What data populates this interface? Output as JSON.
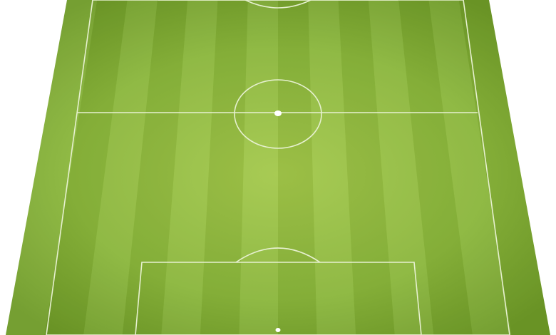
{
  "pitch": {
    "grass_light": "#a3c84a",
    "grass_mid": "#8ab63b",
    "grass_dark": "#6e9a27",
    "line_color": "#e6f0cf",
    "view": "perspective"
  }
}
